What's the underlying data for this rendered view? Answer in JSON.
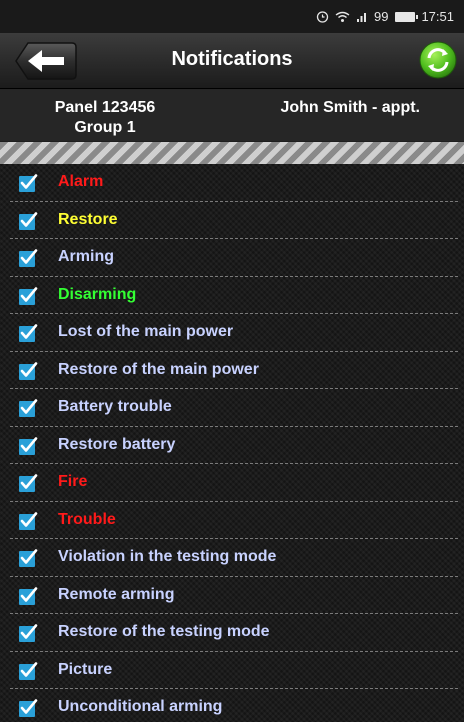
{
  "status_bar": {
    "signal": "99",
    "time": "17:51"
  },
  "header": {
    "title": "Notifications",
    "back_icon": "arrow-left-icon",
    "refresh_icon": "refresh-icon"
  },
  "panel": {
    "name": "Panel 123456",
    "group": "Group 1",
    "user": "John Smith - appt."
  },
  "colors": {
    "red": "#ff1a1a",
    "yellow": "#ffff33",
    "green": "#33ff33",
    "default": "#c8d2ff",
    "checkbox": "#2aa0d8"
  },
  "notifications": [
    {
      "label": "Alarm",
      "color": "red",
      "checked": true
    },
    {
      "label": "Restore",
      "color": "yellow",
      "checked": true
    },
    {
      "label": "Arming",
      "color": "default",
      "checked": true
    },
    {
      "label": "Disarming",
      "color": "green",
      "checked": true
    },
    {
      "label": "Lost of the main power",
      "color": "default",
      "checked": true
    },
    {
      "label": "Restore of the main power",
      "color": "default",
      "checked": true
    },
    {
      "label": "Battery trouble",
      "color": "default",
      "checked": true
    },
    {
      "label": "Restore battery",
      "color": "default",
      "checked": true
    },
    {
      "label": "Fire",
      "color": "red",
      "checked": true
    },
    {
      "label": "Trouble",
      "color": "red",
      "checked": true
    },
    {
      "label": "Violation in the testing mode",
      "color": "default",
      "checked": true
    },
    {
      "label": "Remote arming",
      "color": "default",
      "checked": true
    },
    {
      "label": "Restore of the testing mode",
      "color": "default",
      "checked": true
    },
    {
      "label": "Picture",
      "color": "default",
      "checked": true
    },
    {
      "label": "Unconditional arming",
      "color": "default",
      "checked": true
    }
  ]
}
